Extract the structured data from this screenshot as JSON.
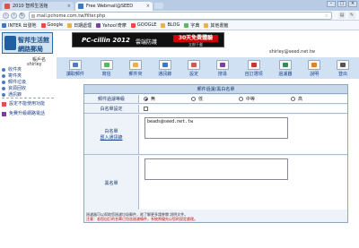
{
  "browser": {
    "tabs": [
      {
        "label": "2010 智邦生活館",
        "favicon_color": "#d9534f"
      },
      {
        "label": "Free Webmail@SEED",
        "favicon_color": "#3a77c8"
      }
    ],
    "url": "mail.pchome.com.tw/filter.php",
    "bookmarks": [
      {
        "label": "INTER 出發地",
        "color": "#3a77c8"
      },
      {
        "label": "Google",
        "color": "#e74c3c"
      },
      {
        "label": "日期處理",
        "color": "#f0ad4e"
      },
      {
        "label": "Yahoo!奇摩",
        "color": "#7b3fa0"
      },
      {
        "label": "GOOGLE",
        "color": "#e74c3c"
      },
      {
        "label": "BLOG",
        "color": "#f0ad4e"
      },
      {
        "label": "字典",
        "color": "#5cb85c"
      },
      {
        "label": "其他書籤",
        "color": "#f0ad4e"
      }
    ]
  },
  "sidebar": {
    "logo_line1": "智邦生活館",
    "logo_line2": "網路郵局",
    "account_label": "帳戶名",
    "account_name": "shirley",
    "menu": [
      "收件夾",
      "寄件夾",
      "郵件垃圾",
      "資源回收",
      "通訊錄"
    ],
    "boxes": [
      {
        "label": "設定不能使用功能",
        "color": "#d9534f"
      },
      {
        "label": "免費升級網路電話",
        "color": "#7b3fa0"
      }
    ]
  },
  "banner": {
    "brand": "PC-cillin 2012",
    "tagline": "雲端防護",
    "cta": "30天免費體驗",
    "sub": "立即下載"
  },
  "header": {
    "email_info": "shirley@seed.net.tw"
  },
  "toolbar": [
    {
      "label": "讀取郵件",
      "color": "#4a7cc0"
    },
    {
      "label": "寫信",
      "color": "#5cb85c"
    },
    {
      "label": "郵件夾",
      "color": "#f0ad4e"
    },
    {
      "label": "通訊錄",
      "color": "#3a77c8"
    },
    {
      "label": "設定",
      "color": "#d9534f"
    },
    {
      "label": "搜尋",
      "color": "#7b3fa0"
    },
    {
      "label": "自訂選項",
      "color": "#c0392b"
    },
    {
      "label": "過濾器",
      "color": "#2c8f5e"
    },
    {
      "label": "說明",
      "color": "#e67e22"
    },
    {
      "label": "登出",
      "color": "#555555"
    }
  ],
  "form": {
    "title": "郵件過濾/黑白名單",
    "row1_label": "郵件過濾等級",
    "levels": [
      "無",
      "低",
      "中等",
      "高"
    ],
    "row2_label": "白名單設定",
    "row3_label": "白名單",
    "row3_link": "匯入通訊錄",
    "whitelist_value": "beads@seed.net.tw",
    "row4_label": "黑名單",
    "note1": "過濾器可以幫助您過濾垃圾郵件，欲了解更多請參閱 說明文件。",
    "note_link": "說明",
    "note2": "注意：若您自訂的名單已包含過濾條件，系統將優先以您的設定處理。"
  }
}
